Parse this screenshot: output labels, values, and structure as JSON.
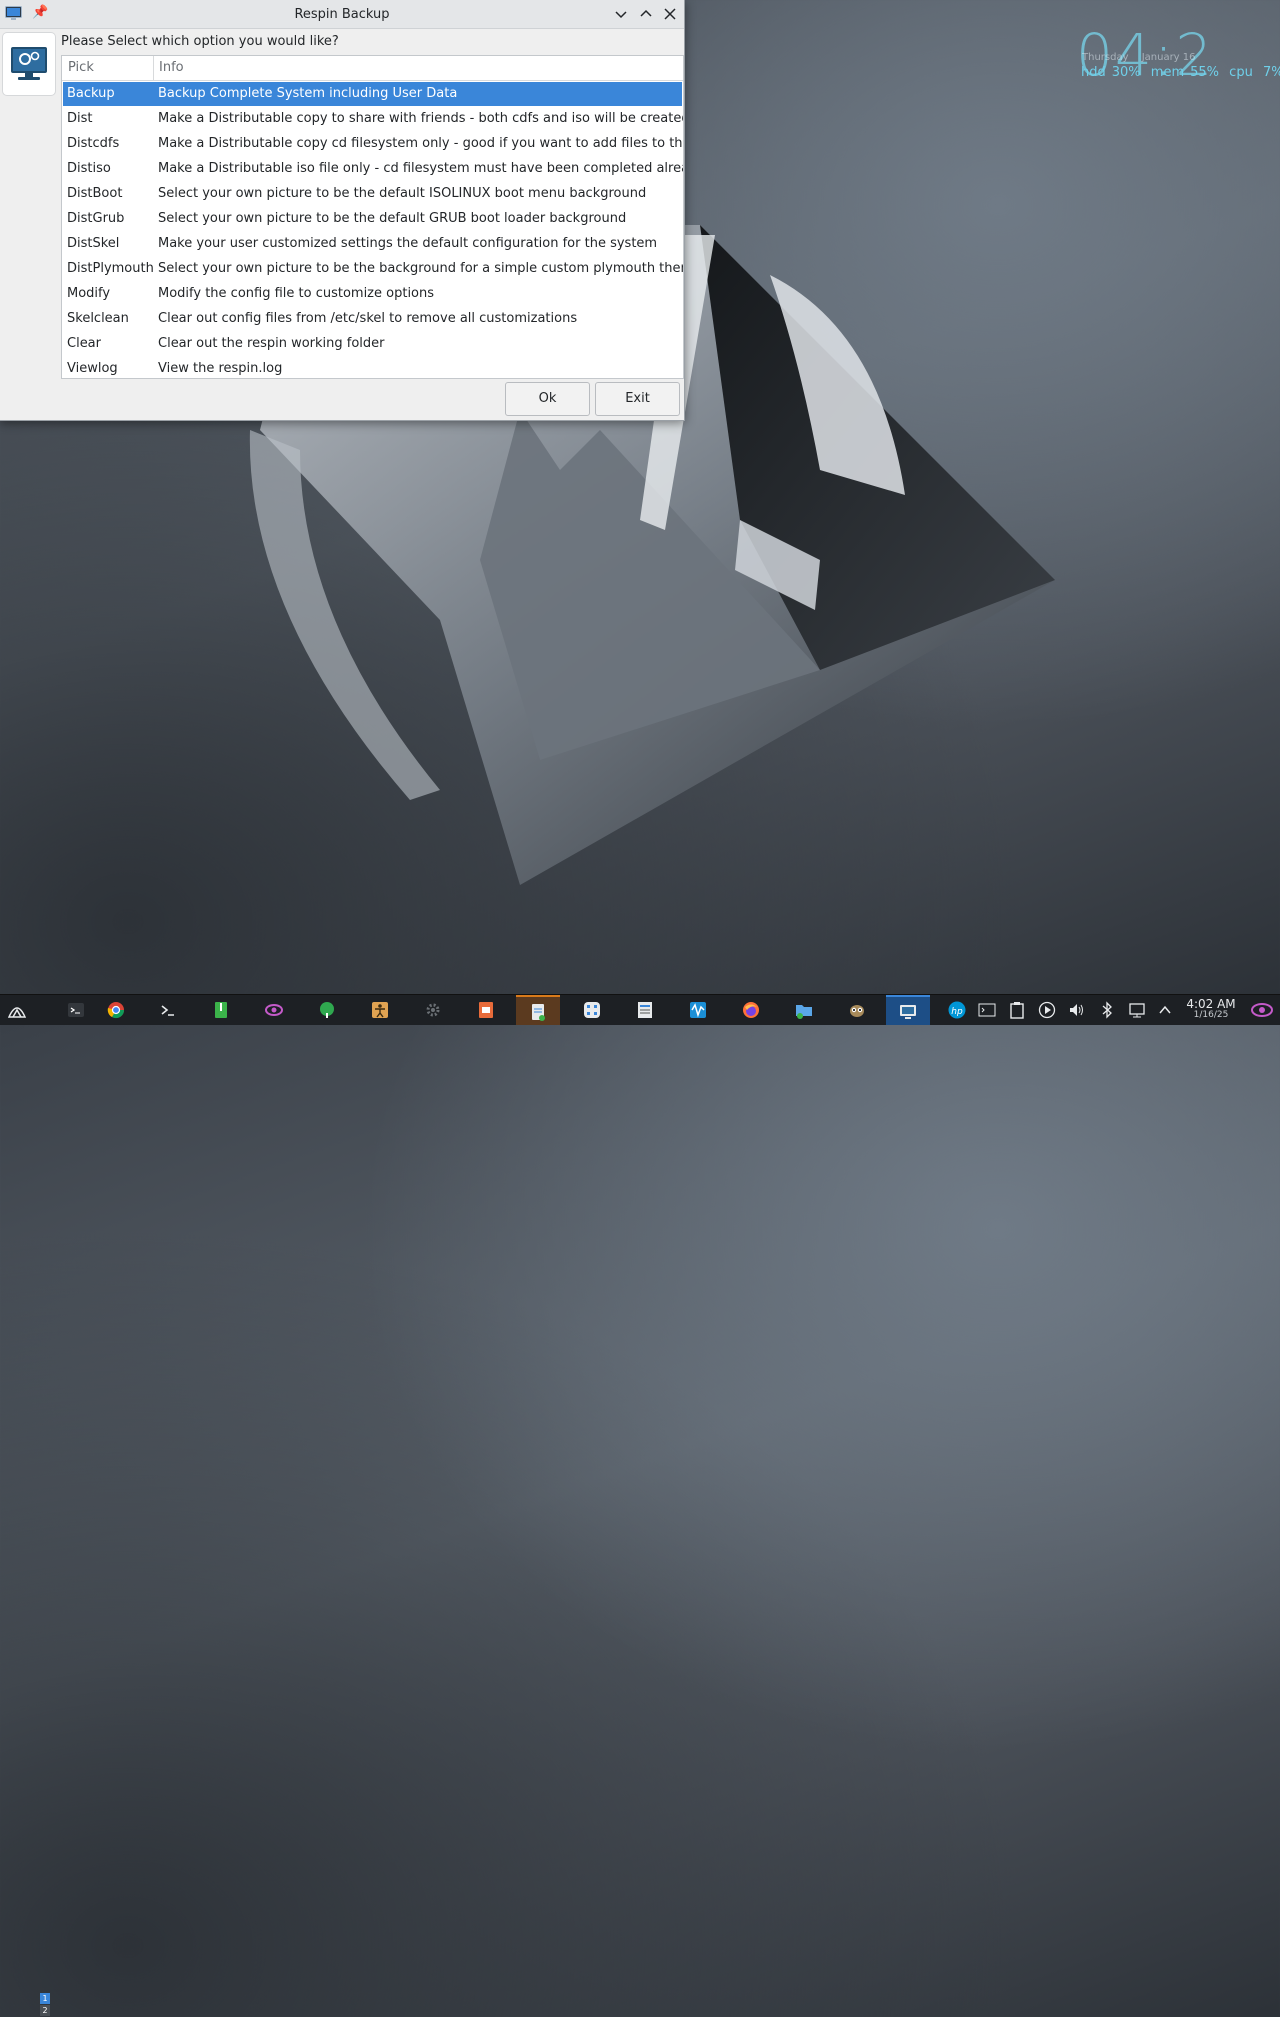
{
  "window": {
    "title": "Respin Backup"
  },
  "dialog": {
    "prompt": "Please Select which option you would like?",
    "columns": [
      "Pick",
      "Info"
    ],
    "rows": [
      {
        "pick": "Backup",
        "info": "Backup Complete System including User Data",
        "selected": true
      },
      {
        "pick": "Dist",
        "info": "Make a Distributable copy to share with friends - both cdfs and iso will be created"
      },
      {
        "pick": "Distcdfs",
        "info": "Make a Distributable copy cd filesystem only - good if you want to add files to the cd"
      },
      {
        "pick": "Distiso",
        "info": "Make a Distributable iso file only - cd filesystem must have been completed already"
      },
      {
        "pick": "DistBoot",
        "info": "Select your own picture to be the default ISOLINUX boot menu background"
      },
      {
        "pick": "DistGrub",
        "info": "Select your own picture to be the default GRUB boot loader background"
      },
      {
        "pick": "DistSkel",
        "info": "Make your user customized settings the default configuration for the system"
      },
      {
        "pick": "DistPlymouth",
        "info": "Select your own picture to be the background for a simple custom plymouth theme"
      },
      {
        "pick": "Modify",
        "info": "Modify the  config file to customize options"
      },
      {
        "pick": "Skelclean",
        "info": "Clear out config files from /etc/skel to remove all customizations"
      },
      {
        "pick": "Clear",
        "info": "Clear out the respin working folder"
      },
      {
        "pick": "Viewlog",
        "info": "View the respin.log"
      }
    ],
    "ok_label": "Ok",
    "exit_label": "Exit"
  },
  "conky": {
    "time": "04:2",
    "day": "Thursday",
    "date": "January 16",
    "hdd": "hdd",
    "hdd_pct": "30%",
    "mem": "mem",
    "mem_pct": "55%",
    "cpu": "cpu",
    "cpu_pct": "7%"
  },
  "taskbar": {
    "pager": [
      "1",
      "2"
    ],
    "clock_time": "4:02 AM",
    "clock_date": "1/16/25"
  },
  "colors": {
    "selection": "#3a86d9",
    "conky": "#6fd0ea",
    "taskbar": "#1d2024"
  }
}
